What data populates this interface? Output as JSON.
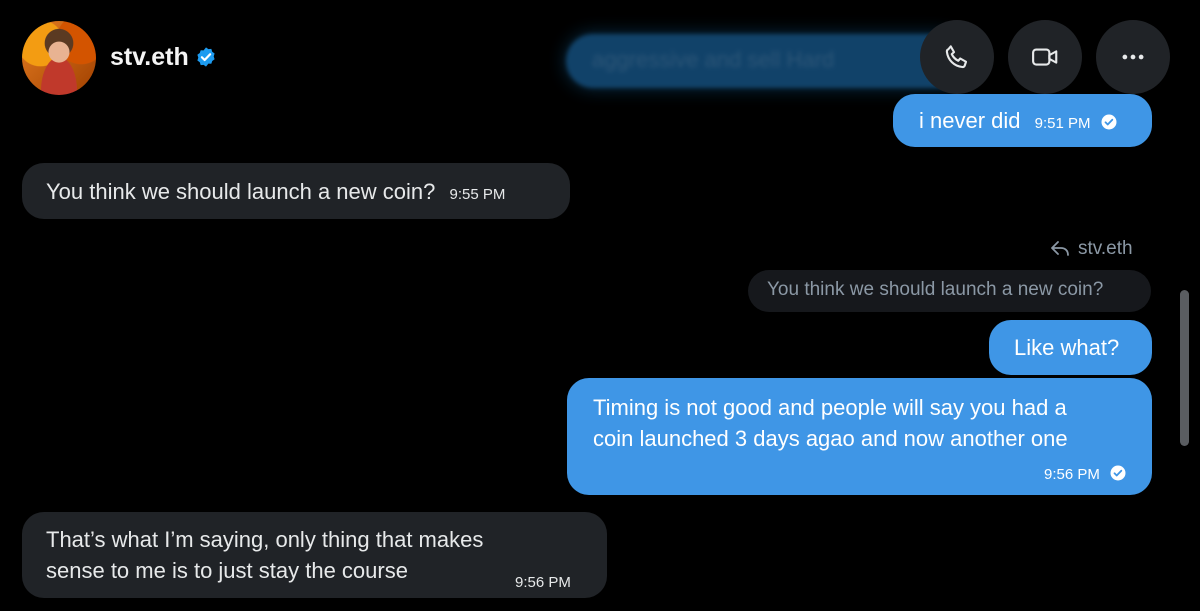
{
  "header": {
    "contact_name": "stv.eth",
    "verified_color": "#1d9bf0",
    "buttons": [
      "phone-icon",
      "video-icon",
      "more-icon"
    ]
  },
  "messages": [
    {
      "side": "sent",
      "text": "aggressive and sell Hard",
      "state": "blurred"
    },
    {
      "side": "sent",
      "text": "i never did",
      "time": "9:51 PM",
      "read": true
    },
    {
      "side": "received",
      "text": "You think we should launch a new coin?",
      "time": "9:55 PM"
    },
    {
      "side": "sent",
      "reply_to": {
        "author": "stv.eth",
        "text": "You think we should launch a new coin?"
      },
      "text": "Like what?"
    },
    {
      "side": "sent",
      "lines": [
        "Timing is not good and people will say you had a",
        "coin launched 3 days agao and now another one"
      ],
      "time": "9:56 PM",
      "read": true
    },
    {
      "side": "received",
      "lines": [
        "That’s what I’m saying, only thing that makes",
        "sense to me is to just stay the course"
      ],
      "time": "9:56 PM"
    }
  ],
  "colors": {
    "sent_bubble": "#3f96e6",
    "received_bubble": "#202327",
    "background": "#000000"
  }
}
